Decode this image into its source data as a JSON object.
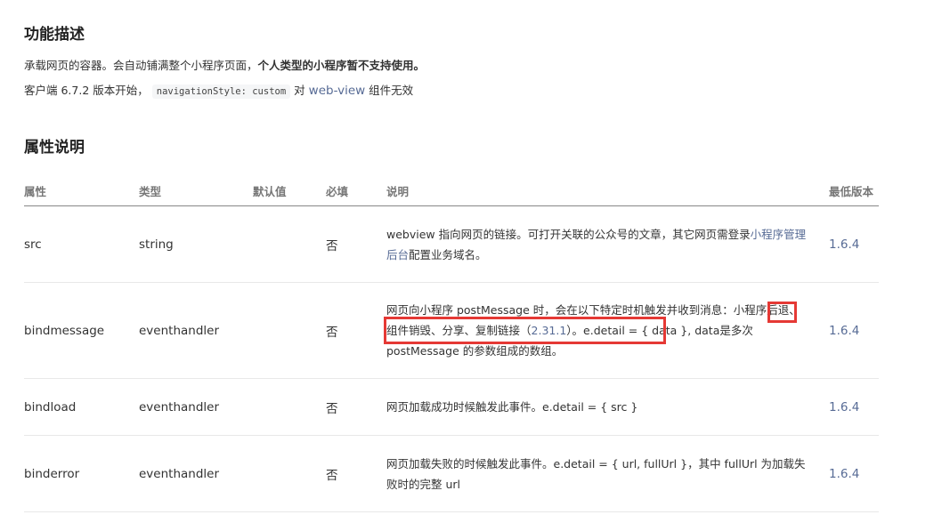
{
  "section1": {
    "title": "功能描述",
    "line1_normal": "承载网页的容器。会自动铺满整个小程序页面，",
    "line1_bold": "个人类型的小程序暂不支持使用。",
    "line2_prefix": "客户端 6.7.2 版本开始，",
    "line2_code": "navigationStyle: custom",
    "line2_mid": "对",
    "line2_link": "web-view",
    "line2_suffix": "组件无效"
  },
  "section2": {
    "title": "属性说明",
    "headers": [
      "属性",
      "类型",
      "默认值",
      "必填",
      "说明",
      "最低版本"
    ],
    "rows": [
      {
        "attr": "src",
        "type": "string",
        "default": "",
        "required": "否",
        "desc_text": "webview 指向网页的链接。可打开关联的公众号的文章，其它网页需登录",
        "desc_link": "小程序管理后台",
        "desc_after": "配置业务域名。",
        "version": "1.6.4"
      },
      {
        "attr": "bindmessage",
        "type": "eventhandler",
        "default": "",
        "required": "否",
        "desc_text": "网页向小程序 postMessage 时，会在以下特定时机触发并收到消息：小程序后退、组件销毁、分享、复制链接（",
        "desc_link": "2.31.1",
        "desc_after": "）。e.detail = { data }, data是多次 postMessage 的参数组成的数组。",
        "version": "1.6.4"
      },
      {
        "attr": "bindload",
        "type": "eventhandler",
        "default": "",
        "required": "否",
        "desc_text": "网页加载成功时候触发此事件。e.detail = { src }",
        "version": "1.6.4"
      },
      {
        "attr": "binderror",
        "type": "eventhandler",
        "default": "",
        "required": "否",
        "desc_text": "网页加载失败的时候触发此事件。e.detail = { url, fullUrl }，其中 fullUrl 为加载失败时的完整 url",
        "version": "1.6.4"
      }
    ]
  }
}
